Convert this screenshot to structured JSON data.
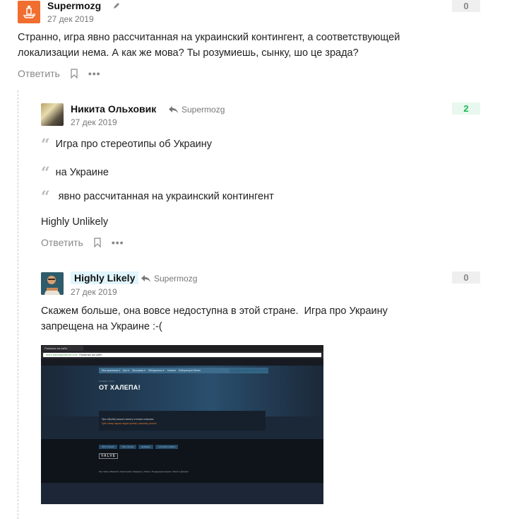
{
  "comments": [
    {
      "author": "Supermozg",
      "edited_icon": "pencil-icon",
      "date": "27 дек 2019",
      "score": "0",
      "text": "Странно, игра явно рассчитанная на украинский контингент, а соответствующей локализации нема. А как же мова? Ты розумиешь, сынку, шо це зрада?",
      "actions": {
        "reply": "Ответить",
        "bookmark_icon": "bookmark-icon",
        "more_icon": "more-icon"
      }
    },
    {
      "author": "Никита Ольховик",
      "reply_to": "Supermozg",
      "date": "27 дек 2019",
      "score": "2",
      "quotes": [
        "Игра про стереотипы об Украину",
        "на Украине",
        " явно рассчитанная на украинский контингент"
      ],
      "text": "Highly Unlikely",
      "actions": {
        "reply": "Ответить"
      }
    },
    {
      "author": "Highly Likely",
      "reply_to": "Supermozg",
      "date": "27 дек 2019",
      "score": "0",
      "text_line1": "Скажем больше, она вовсе недоступна в этой стране.  Игра про Украину",
      "text_line2": "запрещена на Украине :-(",
      "image": {
        "tab_title": "Помилка на сайті",
        "url": "store.steampowered.com",
        "url_title": "Помилка на сайті",
        "nav": [
          "Моя крамниця ▾",
          "Ігри ▾",
          "Програми ▾",
          "Обладнання ▾",
          "Новини",
          "Лабораторія Steam"
        ],
        "search_placeholder": "шукати в крамниці",
        "breadcrumb": "Головна > Стор",
        "title": "ОТ ХАЛЕПА!",
        "message": "При обробці вашого запиту сталася помилка:",
        "error": "Цей товар наразі недоступний у вашому регіоні",
        "footer_buttons": [
          "ПРО STEAM",
          "ПРО VALVE",
          "ДОВІДКА",
          "СТРІЧКИ НОВИН"
        ],
        "valve_logo": "VALVE",
        "footer_links": "Про Valve | Вакансії | Steamworks | Видання у Steam | Подарункові картки | Steam | @steam"
      }
    }
  ]
}
